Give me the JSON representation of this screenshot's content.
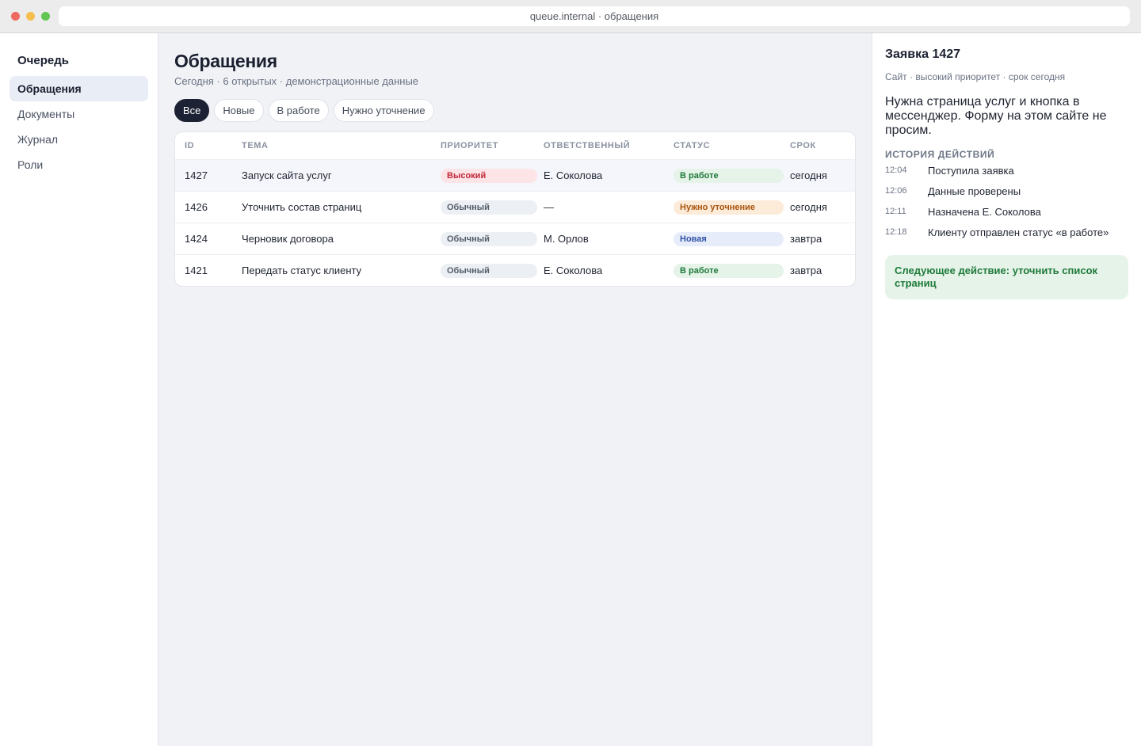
{
  "browser": {
    "url": "queue.internal · обращения"
  },
  "sidebar": {
    "title": "Очередь",
    "items": [
      {
        "label": "Обращения",
        "active": true
      },
      {
        "label": "Документы"
      },
      {
        "label": "Журнал"
      },
      {
        "label": "Роли"
      }
    ]
  },
  "main": {
    "title": "Обращения",
    "subtitle": "Сегодня · 6 открытых · демонстрационные данные",
    "filters": [
      "Все",
      "Новые",
      "В работе",
      "Нужно уточнение"
    ],
    "active_filter": "Все",
    "table": {
      "headers": [
        "ID",
        "ТЕМА",
        "ПРИОРИТЕТ",
        "ОТВЕТСТВЕННЫЙ",
        "СТАТУС",
        "СРОК"
      ],
      "rows": [
        {
          "id": "1427",
          "topic": "Запуск сайта услуг",
          "priority": "Высокий",
          "owner": "Е. Соколова",
          "status": "В работе",
          "due": "сегодня"
        },
        {
          "id": "1426",
          "topic": "Уточнить состав страниц",
          "priority": "Обычный",
          "owner": "—",
          "status": "Нужно уточнение",
          "due": "сегодня"
        },
        {
          "id": "1424",
          "topic": "Черновик договора",
          "priority": "Обычный",
          "owner": "М. Орлов",
          "status": "Новая",
          "due": "завтра"
        },
        {
          "id": "1421",
          "topic": "Передать статус клиенту",
          "priority": "Обычный",
          "owner": "Е. Соколова",
          "status": "В работе",
          "due": "завтра"
        }
      ]
    }
  },
  "detail": {
    "title": "Заявка 1427",
    "meta": "Сайт · высокий приоритет · срок сегодня",
    "description": "Нужна страница услуг и кнопка в мессенджер. Форму на этом сайте не просим.",
    "history_title": "ИСТОРИЯ ДЕЙСТВИЙ",
    "history": [
      {
        "time": "12:04",
        "text": "Поступила заявка"
      },
      {
        "time": "12:06",
        "text": "Данные проверены"
      },
      {
        "time": "12:11",
        "text": "Назначена Е. Соколова"
      },
      {
        "time": "12:18",
        "text": "Клиенту отправлен статус «в работе»"
      }
    ],
    "next_action": "Следующее действие: уточнить список страниц"
  },
  "colors": {
    "accent_dark": "#1c2233",
    "priority_high": "#c0283a",
    "status_in_work": "#1e7a3a",
    "status_clarify": "#a9550e",
    "status_new": "#3252a6"
  }
}
